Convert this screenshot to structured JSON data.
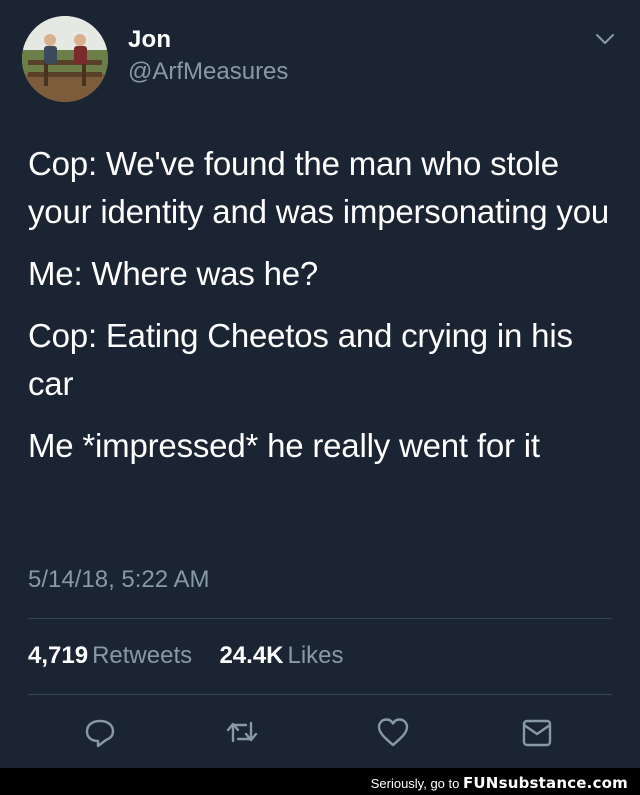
{
  "tweet": {
    "author": {
      "display_name": "Jon",
      "handle": "@ArfMeasures",
      "avatar_icon": "profile-photo-two-men-on-fence"
    },
    "menu_icon": "chevron-down-icon",
    "body": [
      "Cop: We've found the man who stole your identity and was impersonating you",
      "Me: Where was he?",
      "Cop: Eating Cheetos and crying in his car",
      "Me *impressed* he really went for it"
    ],
    "timestamp": "5/14/18, 5:22 AM",
    "stats": {
      "retweets_count": "4,719",
      "retweets_label": "Retweets",
      "likes_count": "24.4K",
      "likes_label": "Likes"
    },
    "actions": [
      {
        "name": "reply",
        "icon": "speech-bubble-icon"
      },
      {
        "name": "retweet",
        "icon": "retweet-arrows-icon"
      },
      {
        "name": "like",
        "icon": "heart-icon"
      },
      {
        "name": "direct-message",
        "icon": "envelope-icon"
      }
    ]
  },
  "footer": {
    "prefix": "Seriously, go to",
    "brand": "FUNsubstance.com"
  },
  "colors": {
    "background": "#1b2432",
    "secondary_text": "#8899a6",
    "primary_text": "#ffffff",
    "divider": "#38444d",
    "footer_background": "#000000"
  }
}
